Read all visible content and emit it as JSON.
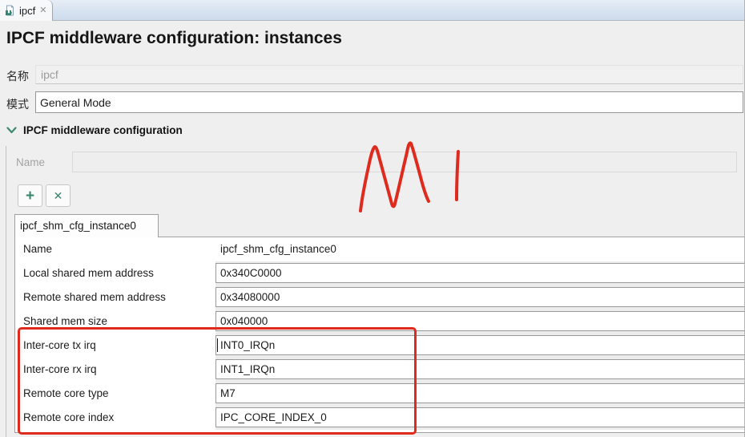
{
  "editor_tab": {
    "label": "ipcf",
    "icon": "plugin-file-icon",
    "close_glyph": "✕"
  },
  "header": {
    "title": "IPCF middleware configuration: instances"
  },
  "form": {
    "name_label": "名称",
    "name_value": "ipcf",
    "mode_label": "模式",
    "mode_value": "General Mode"
  },
  "section": {
    "title": "IPCF middleware configuration",
    "chevron": "expanded"
  },
  "instances_panel": {
    "name_label": "Name",
    "name_value": "",
    "add_button_glyph": "+",
    "remove_button_glyph": "✕",
    "instance_tab_label": "ipcf_shm_cfg_instance0",
    "rows": [
      {
        "label": "Name",
        "value": "ipcf_shm_cfg_instance0",
        "editable": false,
        "caret": false
      },
      {
        "label": "Local shared mem address",
        "value": "0x340C0000",
        "editable": true,
        "caret": false
      },
      {
        "label": "Remote shared mem address",
        "value": "0x34080000",
        "editable": true,
        "caret": false
      },
      {
        "label": "Shared mem size",
        "value": "0x040000",
        "editable": true,
        "caret": false
      },
      {
        "label": "Inter-core tx irq",
        "value": "INT0_IRQn",
        "editable": true,
        "caret": true
      },
      {
        "label": "Inter-core rx irq",
        "value": "INT1_IRQn",
        "editable": true,
        "caret": false
      },
      {
        "label": "Remote core type",
        "value": "M7",
        "editable": true,
        "caret": false
      },
      {
        "label": "Remote core index",
        "value": "IPC_CORE_INDEX_0",
        "editable": true,
        "caret": false
      }
    ]
  },
  "annotations": {
    "stroke_color": "#df2a1e",
    "rectangle_highlights_rows": [
      "Inter-core tx irq",
      "Inter-core rx irq",
      "Remote core type",
      "Remote core index"
    ],
    "freehand_marks": [
      "M-shaped scribble",
      "vertical stroke"
    ]
  },
  "colors": {
    "accent_green": "#37876d",
    "annotation_red": "#df2a1e",
    "tabbar_blue": "#cddbec",
    "page_background": "#efeff0"
  }
}
